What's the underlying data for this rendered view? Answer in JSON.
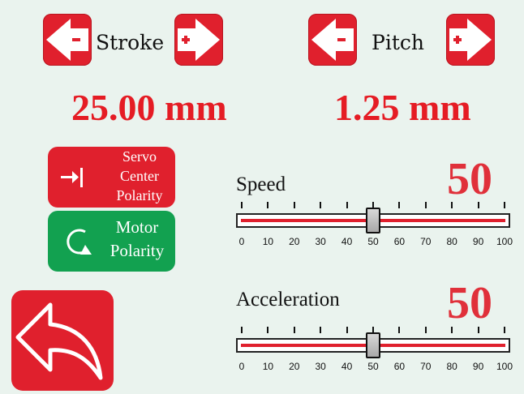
{
  "stroke": {
    "label": "Stroke",
    "value": "25.00 mm"
  },
  "pitch": {
    "label": "Pitch",
    "value": "1.25 mm"
  },
  "servo_polarity": {
    "line1": "Servo",
    "line2": "Center",
    "line3": "Polarity"
  },
  "motor_polarity": {
    "line1": "Motor",
    "line2": "Polarity"
  },
  "speed": {
    "label": "Speed",
    "value": "50",
    "level": 50
  },
  "acceleration": {
    "label": "Acceleration",
    "value": "50",
    "level": 50
  },
  "scale": {
    "t0": "0",
    "t1": "10",
    "t2": "20",
    "t3": "30",
    "t4": "40",
    "t5": "50",
    "t6": "60",
    "t7": "70",
    "t8": "80",
    "t9": "90",
    "t10": "100"
  },
  "colors": {
    "red": "#e0202d",
    "green": "#12a150",
    "value_red": "#e51c24",
    "background": "#eaf3ee"
  },
  "icons": {
    "minus": "arrow-left-minus-icon",
    "plus": "arrow-right-plus-icon",
    "servo": "servo-center-icon",
    "motor": "rotate-icon",
    "back": "back-arrow-icon"
  }
}
